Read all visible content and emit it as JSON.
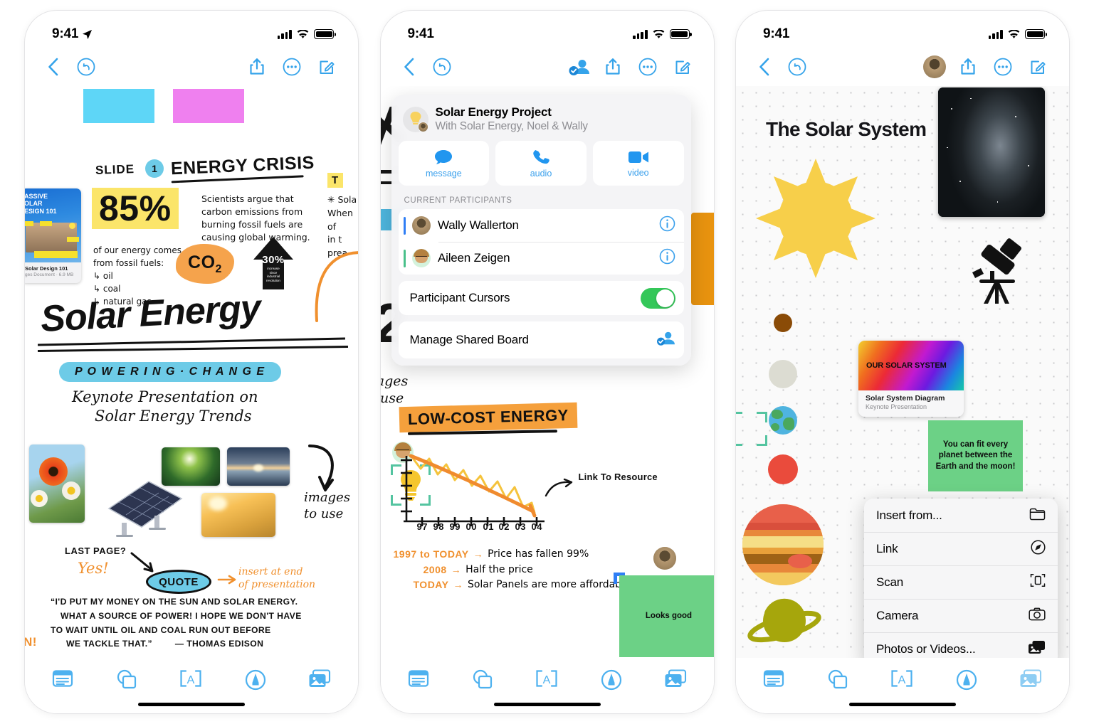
{
  "status_bar": {
    "time": "9:41",
    "location_icon": "location-arrow-icon",
    "cellular_icon": "cellular-bars-icon",
    "wifi_icon": "wifi-icon",
    "battery_icon": "battery-icon"
  },
  "nav": {
    "back_icon": "chevron-left-icon",
    "undo_icon": "undo-arrow-icon",
    "collaborate_icon": "collaborate-person-check-icon",
    "share_icon": "share-up-arrow-icon",
    "more_icon": "ellipsis-circle-icon",
    "compose_icon": "compose-pencil-square-icon",
    "avatar_icon": "user-avatar-icon"
  },
  "bottom_toolbar": {
    "items": [
      {
        "name": "note-tool",
        "icon": "sticky-note-icon"
      },
      {
        "name": "shapes-tool",
        "icon": "shapes-overlap-icon"
      },
      {
        "name": "text-tool",
        "icon": "text-box-a-icon"
      },
      {
        "name": "draw-tool",
        "icon": "pen-circle-icon"
      },
      {
        "name": "media-tool",
        "icon": "photos-stack-icon"
      }
    ]
  },
  "panel1": {
    "slide_label": "SLIDE",
    "slide_number": "1",
    "slide_heading": "ENERGY CRISIS",
    "stat_big": "85%",
    "stat_body": [
      "Scientists argue that",
      "carbon emissions from",
      "burning fossil fuels are",
      "causing global warming."
    ],
    "stat_sub": [
      "of our energy comes",
      "from fossil fuels:",
      "↳ oil",
      "↳ coal",
      "↳ natural gas"
    ],
    "co2_badge": "CO2",
    "arrow_badge_percent": "30%",
    "arrow_badge_sub": [
      "increase",
      "since",
      "industrial",
      "revolution"
    ],
    "title_main": "Solar Energy",
    "title_tagline": "P O W E R I N G  ·  C H A N G E",
    "subtitle": [
      "Keynote Presentation on",
      "Solar Energy Trends"
    ],
    "images_note": [
      "images",
      "to use"
    ],
    "last_page_q": "LAST PAGE?",
    "last_page_a": "Yes!",
    "quote_bubble": "QUOTE",
    "insert_note": [
      "insert at end",
      "of presentation"
    ],
    "quote_lines": [
      "“I'D PUT MY MONEY ON THE SUN AND SOLAR ENERGY.",
      "WHAT A SOURCE OF POWER! I HOPE WE DON'T HAVE",
      "TO WAIT UNTIL OIL AND COAL RUN OUT BEFORE",
      "WE TACKLE THAT.”"
    ],
    "quote_attribution": "— THOMAS EDISON",
    "edge_note_right": [
      "T",
      "✳ Sola",
      "When",
      "of",
      "in t",
      "prea"
    ],
    "edge_note_left": "N!",
    "doc_card": {
      "cover_lines": [
        "ASSIVE",
        "OLAR",
        "ESIGN 101"
      ],
      "title": "Solar Design 101",
      "subtitle": "ges Document · 6.9 MB"
    }
  },
  "panel2": {
    "popover": {
      "title": "Solar Energy Project",
      "subtitle": "With Solar Energy, Noel & Wally",
      "quick_actions": [
        {
          "label": "message",
          "icon": "message-bubble-icon"
        },
        {
          "label": "audio",
          "icon": "phone-handset-icon"
        },
        {
          "label": "video",
          "icon": "video-camera-icon"
        }
      ],
      "section_label": "CURRENT PARTICIPANTS",
      "participants": [
        {
          "name": "Wally Wallerton",
          "color": "#2f7ef5",
          "info_icon": "info-circle-icon"
        },
        {
          "name": "Aileen Zeigen",
          "color": "#49c08a",
          "info_icon": "info-circle-icon"
        }
      ],
      "toggle_row": {
        "label": "Participant Cursors",
        "state": "on",
        "color": "#34c759"
      },
      "manage_row": {
        "label": "Manage Shared Board",
        "icon": "manage-participants-icon"
      }
    },
    "chart_heading": "LOW-COST ENERGY",
    "link_annotation": "Link To Resource",
    "notes": [
      {
        "key": "1997 to TODAY",
        "arrow": "→",
        "value": "Price has fallen 99%"
      },
      {
        "key": "2008",
        "arrow": "→",
        "value": "Half the price"
      },
      {
        "key": "TODAY",
        "arrow": "→",
        "value": "Solar Panels are more affordable"
      }
    ],
    "sticky_note": "Looks good",
    "edge_note": [
      "nages",
      "o use"
    ],
    "selected_object": "lightbulb-sticker",
    "cursor_avatar": "participant-avatar-icon"
  },
  "chart_data": {
    "type": "line",
    "title": "LOW-COST ENERGY",
    "xlabel": "",
    "ylabel": "",
    "categories": [
      "97",
      "98",
      "99",
      "00",
      "01",
      "02",
      "03",
      "04"
    ],
    "series": [
      {
        "name": "price (zig-zag)",
        "color": "#f5c33c",
        "values": [
          92,
          68,
          84,
          57,
          72,
          48,
          62,
          38,
          52,
          28,
          42,
          18,
          30,
          12,
          20
        ]
      },
      {
        "name": "trend",
        "color": "#f08b2e",
        "values": [
          95,
          82,
          70,
          58,
          46,
          34,
          24,
          16
        ]
      }
    ],
    "annotations": [
      "Link To Resource"
    ],
    "xlim": [
      1997,
      2004
    ],
    "ylim": [
      0,
      100
    ],
    "grid": false,
    "legend": "none"
  },
  "panel3": {
    "board_title": "The Solar System",
    "galaxy_image": "milky-way-photo",
    "telescope_icon": "telescope-icon",
    "planets": [
      {
        "name": "mercury",
        "color": "#8a4b07",
        "size": 26
      },
      {
        "name": "venus",
        "color": "#dcdcd2",
        "size": 40
      },
      {
        "name": "earth",
        "color": "#4fb4e0",
        "size": 40
      },
      {
        "name": "mars",
        "color": "#ea4b3c",
        "size": 42
      },
      {
        "name": "jupiter",
        "color": "#e8883a",
        "size": 112
      },
      {
        "name": "saturn",
        "color": "#a6a60c",
        "size": 96
      }
    ],
    "keynote_card": {
      "art_text": "OUR SOLAR SYSTEM",
      "title": "Solar System Diagram",
      "subtitle": "Keynote Presentation"
    },
    "sticky_note": "You can fit every planet between the Earth and the moon!",
    "context_menu": [
      {
        "label": "Insert from...",
        "icon": "folder-icon"
      },
      {
        "label": "Link",
        "icon": "compass-link-icon"
      },
      {
        "label": "Scan",
        "icon": "document-scan-icon"
      },
      {
        "label": "Camera",
        "icon": "camera-icon"
      },
      {
        "label": "Photos or Videos...",
        "icon": "photos-stack-icon"
      }
    ]
  },
  "colors": {
    "accent": "#35a3ea",
    "toolbar": "#4db1ef",
    "green": "#34c759",
    "yellow": "#fbe56a",
    "orange": "#f5a03c",
    "note_green": "#6cd186"
  }
}
